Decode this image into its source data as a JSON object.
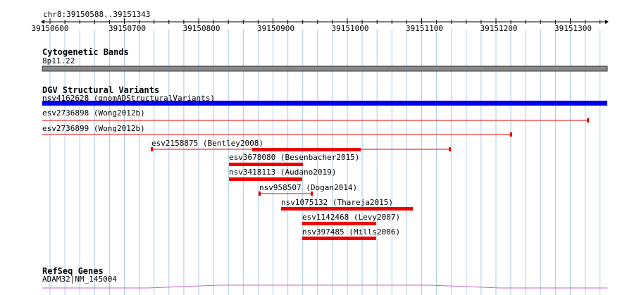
{
  "ruler": {
    "location": "chr8:39150588..39151343",
    "ticks": [
      "39150600",
      "39150700",
      "39150800",
      "39150900",
      "39151000",
      "39151100",
      "39151200",
      "39151300"
    ]
  },
  "tracks": {
    "cytoband": {
      "title": "Cytogenetic Bands",
      "band_label": "8p11.22",
      "color": "#888888"
    },
    "dgv": {
      "title": "DGV Structural Variants",
      "features": [
        {
          "label": "nsv4162628 (gnomADStructuralVariants)",
          "color": "#0000ee",
          "style": "thick"
        },
        {
          "label": "esv2736898 (Wong2012b)",
          "color": "#ee0000",
          "style": "thin"
        },
        {
          "label": "esv2736899 (Wong2012b)",
          "color": "#ee0000",
          "style": "thin"
        },
        {
          "label": "esv2158875 (Bentley2008)",
          "color": "#ee0000",
          "style": "mixed"
        },
        {
          "label": "esv3678080 (Besenbacher2015)",
          "color": "#ee0000",
          "style": "thick"
        },
        {
          "label": "nsv3418113 (Audano2019)",
          "color": "#ee0000",
          "style": "thick"
        },
        {
          "label": "nsv958507 (Dogan2014)",
          "color": "#ee0000",
          "style": "thin"
        },
        {
          "label": "nsv1075132 (Thareja2015)",
          "color": "#ee0000",
          "style": "thick"
        },
        {
          "label": "esv1142468 (Levy2007)",
          "color": "#ee0000",
          "style": "thick"
        },
        {
          "label": "nsv397485 (Mills2006)",
          "color": "#ee0000",
          "style": "thick"
        }
      ]
    },
    "refseq": {
      "title": "RefSeq Genes",
      "gene_label": "ADAM32|NM_145004",
      "color": "#cc66cc"
    }
  }
}
